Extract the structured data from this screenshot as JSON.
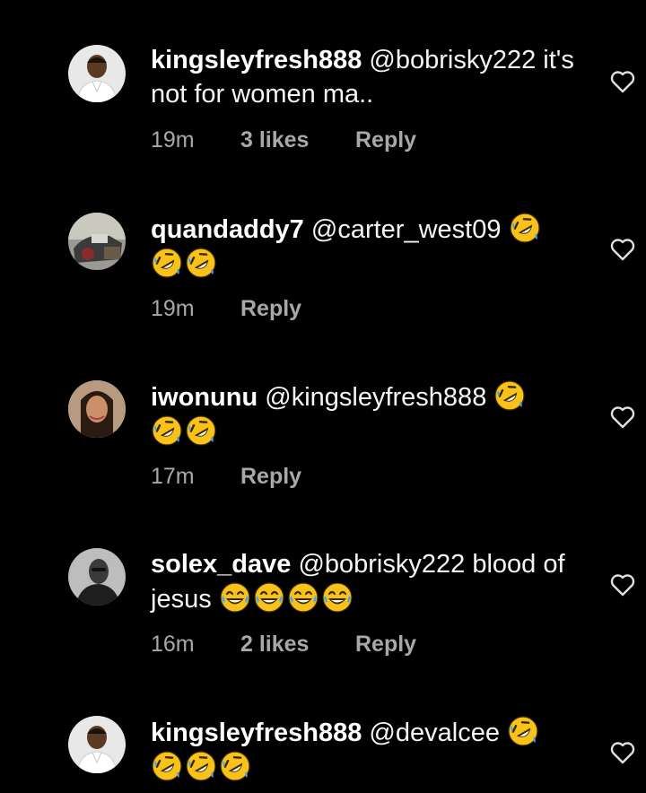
{
  "comments": [
    {
      "username": "kingsleyfresh888",
      "text": "@bobrisky222 it's not for women ma..",
      "time": "19m",
      "likes": "3 likes",
      "reply": "Reply",
      "avatar_icon": "avatar-man-white-shirt",
      "emojis": []
    },
    {
      "username": "quandaddy7",
      "text": "@carter_west09",
      "time": "19m",
      "likes": "",
      "reply": "Reply",
      "avatar_icon": "avatar-car-photo",
      "emojis": [
        "rolling-on-floor-laughing",
        "rolling-on-floor-laughing",
        "rolling-on-floor-laughing"
      ]
    },
    {
      "username": "iwonunu",
      "text": "@kingsleyfresh888",
      "time": "17m",
      "likes": "",
      "reply": "Reply",
      "avatar_icon": "avatar-woman-selfie",
      "emojis": [
        "rolling-on-floor-laughing",
        "rolling-on-floor-laughing",
        "rolling-on-floor-laughing"
      ]
    },
    {
      "username": "solex_dave",
      "text": "@bobrisky222 blood of jesus",
      "time": "16m",
      "likes": "2 likes",
      "reply": "Reply",
      "avatar_icon": "avatar-man-grayscale",
      "emojis": [
        "face-with-tears-of-joy",
        "face-with-tears-of-joy",
        "face-with-tears-of-joy",
        "face-with-tears-of-joy"
      ]
    },
    {
      "username": "kingsleyfresh888",
      "text": "@devalcee",
      "time": "",
      "likes": "",
      "reply": "",
      "avatar_icon": "avatar-man-white-shirt",
      "emojis": [
        "rolling-on-floor-laughing",
        "rolling-on-floor-laughing",
        "rolling-on-floor-laughing",
        "rolling-on-floor-laughing"
      ]
    }
  ],
  "icons": {
    "like": "heart-outline-icon"
  },
  "colors": {
    "background": "#000000",
    "text": "#f5f5f5",
    "meta": "#a8a8a8",
    "emoji_face": "#f9c21b"
  }
}
